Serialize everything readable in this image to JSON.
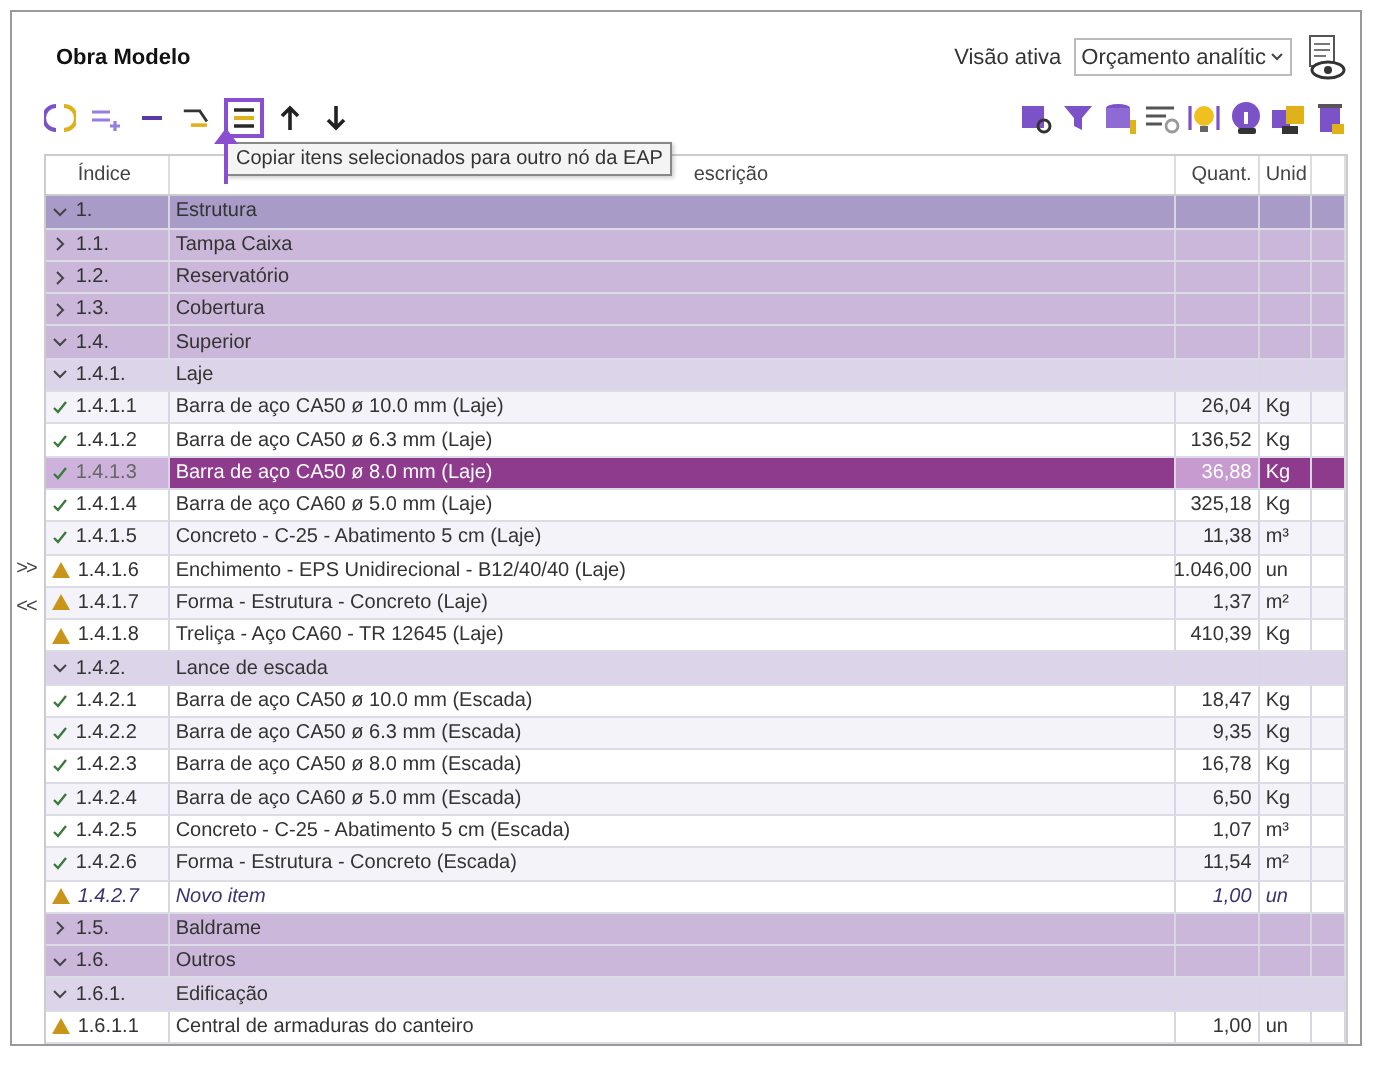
{
  "window": {
    "title": "Obra Modelo"
  },
  "view": {
    "label": "Visão ativa",
    "value": "Orçamento analític"
  },
  "toolbar": [
    {
      "highlighted": false
    },
    {
      "highlighted": false
    },
    {
      "highlighted": false
    },
    {
      "highlighted": false
    },
    {
      "highlighted": true
    },
    {
      "highlighted": false
    },
    {
      "highlighted": false
    }
  ],
  "tooltip": "Copiar itens selecionados para outro nó da EAP",
  "side_nav": [
    ">>",
    "<<"
  ],
  "table": {
    "columns": [
      "Índice",
      "escrição",
      "Quant.",
      "Unid"
    ],
    "tree": [
      {
        "index": "1.",
        "description": "Estrutura",
        "expanded": true,
        "children": [
          {
            "index": "1.1.",
            "description": "Tampa Caixa",
            "expanded": false
          },
          {
            "index": "1.2.",
            "description": "Reservatório",
            "expanded": false
          },
          {
            "index": "1.3.",
            "description": "Cobertura",
            "expanded": false
          },
          {
            "index": "1.4.",
            "description": "Superior",
            "expanded": true,
            "children": [
              {
                "index": "1.4.1.",
                "description": "Laje",
                "expanded": true,
                "children": [
                  {
                    "index": "1.4.1.1",
                    "description": "Barra de aço CA50  ø 10.0 mm  (Laje)",
                    "quantity": "26,04",
                    "unit": "Kg",
                    "warning": false,
                    "new": false,
                    "selected": false
                  },
                  {
                    "index": "1.4.1.2",
                    "description": "Barra de aço CA50  ø 6.3 mm  (Laje)",
                    "quantity": "136,52",
                    "unit": "Kg",
                    "warning": false,
                    "new": false,
                    "selected": false
                  },
                  {
                    "index": "1.4.1.3",
                    "description": "Barra de aço CA50  ø 8.0 mm  (Laje)",
                    "quantity": "36,88",
                    "unit": "Kg",
                    "warning": false,
                    "new": false,
                    "selected": true
                  },
                  {
                    "index": "1.4.1.4",
                    "description": "Barra de aço CA60  ø 5.0 mm  (Laje)",
                    "quantity": "325,18",
                    "unit": "Kg",
                    "warning": false,
                    "new": false,
                    "selected": false
                  },
                  {
                    "index": "1.4.1.5",
                    "description": "Concreto - C-25 - Abatimento 5 cm  (Laje)",
                    "quantity": "11,38",
                    "unit": "m³",
                    "warning": false,
                    "new": false,
                    "selected": false
                  },
                  {
                    "index": "1.4.1.6",
                    "description": "Enchimento - EPS Unidirecional - B12/40/40  (Laje)",
                    "quantity": "1.046,00",
                    "unit": "un",
                    "warning": true,
                    "new": false,
                    "selected": false
                  },
                  {
                    "index": "1.4.1.7",
                    "description": "Forma - Estrutura - Concreto  (Laje)",
                    "quantity": "1,37",
                    "unit": "m²",
                    "warning": true,
                    "new": false,
                    "selected": false
                  },
                  {
                    "index": "1.4.1.8",
                    "description": "Treliça - Aço CA60 - TR 12645  (Laje)",
                    "quantity": "410,39",
                    "unit": "Kg",
                    "warning": true,
                    "new": false,
                    "selected": false
                  }
                ]
              },
              {
                "index": "1.4.2.",
                "description": "Lance de escada",
                "expanded": true,
                "children": [
                  {
                    "index": "1.4.2.1",
                    "description": "Barra de aço CA50  ø 10.0 mm (Escada)",
                    "quantity": "18,47",
                    "unit": "Kg",
                    "warning": false,
                    "new": false,
                    "selected": false
                  },
                  {
                    "index": "1.4.2.2",
                    "description": "Barra de aço CA50  ø 6.3 mm (Escada)",
                    "quantity": "9,35",
                    "unit": "Kg",
                    "warning": false,
                    "new": false,
                    "selected": false
                  },
                  {
                    "index": "1.4.2.3",
                    "description": "Barra de aço CA50  ø 8.0 mm (Escada)",
                    "quantity": "16,78",
                    "unit": "Kg",
                    "warning": false,
                    "new": false,
                    "selected": false
                  },
                  {
                    "index": "1.4.2.4",
                    "description": "Barra de aço CA60  ø 5.0 mm (Escada)",
                    "quantity": "6,50",
                    "unit": "Kg",
                    "warning": false,
                    "new": false,
                    "selected": false
                  },
                  {
                    "index": "1.4.2.5",
                    "description": "Concreto - C-25 - Abatimento 5 cm (Escada)",
                    "quantity": "1,07",
                    "unit": "m³",
                    "warning": false,
                    "new": false,
                    "selected": false
                  },
                  {
                    "index": "1.4.2.6",
                    "description": "Forma - Estrutura - Concreto (Escada)",
                    "quantity": "11,54",
                    "unit": "m²",
                    "warning": false,
                    "new": false,
                    "selected": false
                  },
                  {
                    "index": "1.4.2.7",
                    "description": "Novo item",
                    "quantity": "1,00",
                    "unit": "un",
                    "warning": true,
                    "new": true,
                    "selected": false
                  }
                ]
              }
            ]
          },
          {
            "index": "1.5.",
            "description": "Baldrame",
            "expanded": false
          },
          {
            "index": "1.6.",
            "description": "Outros",
            "expanded": true,
            "children": [
              {
                "index": "1.6.1.",
                "description": "Edificação",
                "expanded": true,
                "children": [
                  {
                    "index": "1.6.1.1",
                    "description": "Central de armaduras do canteiro",
                    "quantity": "1,00",
                    "unit": "un",
                    "warning": true,
                    "new": false,
                    "selected": false
                  }
                ]
              }
            ]
          }
        ]
      }
    ]
  }
}
